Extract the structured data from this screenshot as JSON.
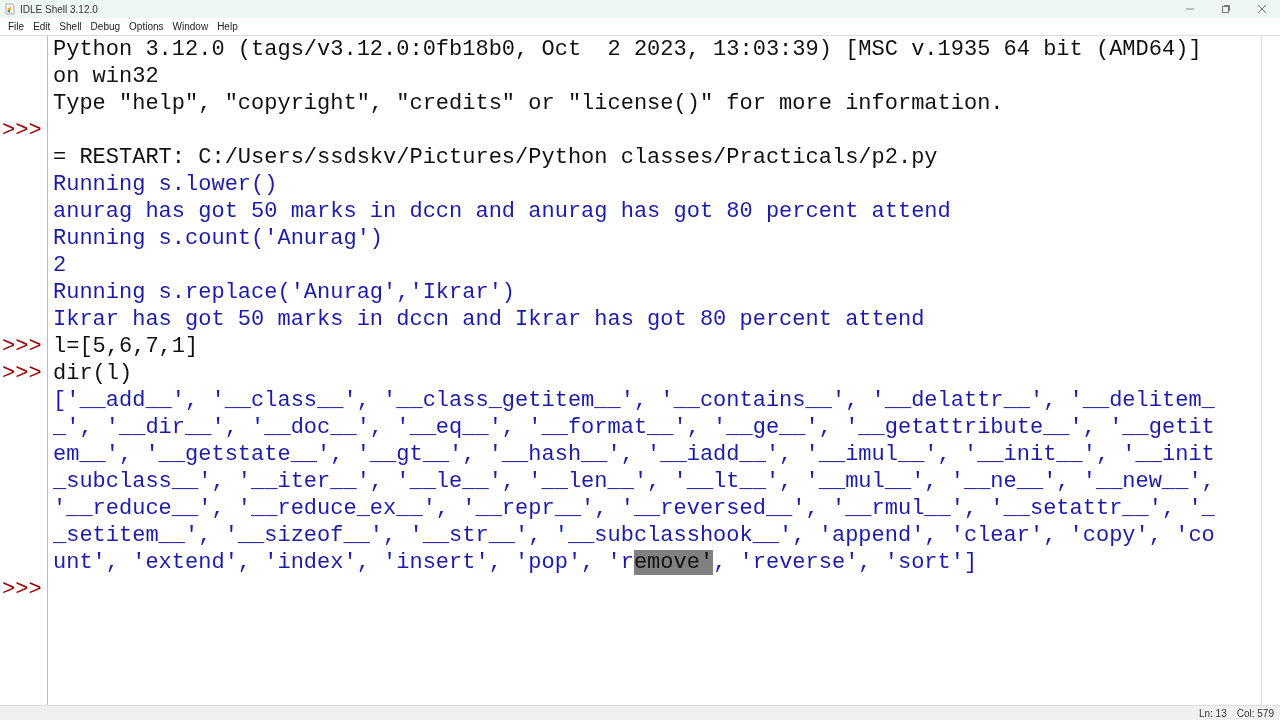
{
  "window": {
    "title": "IDLE Shell 3.12.0"
  },
  "menu": [
    "File",
    "Edit",
    "Shell",
    "Debug",
    "Options",
    "Window",
    "Help"
  ],
  "shell_lines": [
    {
      "kind": "info",
      "text": "Python 3.12.0 (tags/v3.12.0:0fb18b0, Oct  2 2023, 13:03:39) [MSC v.1935 64 bit (AMD64)]"
    },
    {
      "kind": "info",
      "text": "on win32"
    },
    {
      "kind": "info",
      "text": "Type \"help\", \"copyright\", \"credits\" or \"license()\" for more information."
    },
    {
      "kind": "input",
      "prompt": ">>>"
    },
    {
      "kind": "info",
      "text": "= RESTART: C:/Users/ssdskv/Pictures/Python classes/Practicals/p2.py"
    },
    {
      "kind": "stdout",
      "text": "Running s.lower()"
    },
    {
      "kind": "stdout",
      "text": "anurag has got 50 marks in dccn and anurag has got 80 percent attend"
    },
    {
      "kind": "stdout",
      "text": "Running s.count('Anurag')"
    },
    {
      "kind": "stdout",
      "text": "2"
    },
    {
      "kind": "stdout",
      "text": "Running s.replace('Anurag','Ikrar')"
    },
    {
      "kind": "stdout",
      "text": "Ikrar has got 50 marks in dccn and Ikrar has got 80 percent attend"
    },
    {
      "kind": "input",
      "prompt": ">>>",
      "text": "l=[5,6,7,1]"
    },
    {
      "kind": "input",
      "prompt": ">>>",
      "text": "dir(l)"
    },
    {
      "kind": "stdout",
      "text": "['__add__', '__class__', '__class_getitem__', '__contains__', '__delattr__', '__delitem_"
    },
    {
      "kind": "stdout",
      "text": "_', '__dir__', '__doc__', '__eq__', '__format__', '__ge__', '__getattribute__', '__getit"
    },
    {
      "kind": "stdout",
      "text": "em__', '__getstate__', '__gt__', '__hash__', '__iadd__', '__imul__', '__init__', '__init"
    },
    {
      "kind": "stdout",
      "text": "_subclass__', '__iter__', '__le__', '__len__', '__lt__', '__mul__', '__ne__', '__new__',"
    },
    {
      "kind": "stdout",
      "text": "'__reduce__', '__reduce_ex__', '__repr__', '__reversed__', '__rmul__', '__setattr__', '_"
    },
    {
      "kind": "stdout",
      "text": "_setitem__', '__sizeof__', '__str__', '__subclasshook__', 'append', 'clear', 'copy', 'co"
    },
    {
      "kind": "stdout",
      "segments": [
        {
          "text": "unt', 'extend', 'index', 'insert', 'pop', 'r",
          "selected": false
        },
        {
          "text": "emove'",
          "selected": true
        },
        {
          "text": ", 'reverse', 'sort']",
          "selected": false
        }
      ]
    },
    {
      "kind": "input",
      "prompt": ">>>"
    }
  ],
  "status_bar": {
    "line": "Ln: 13",
    "column": "Col: 579"
  }
}
